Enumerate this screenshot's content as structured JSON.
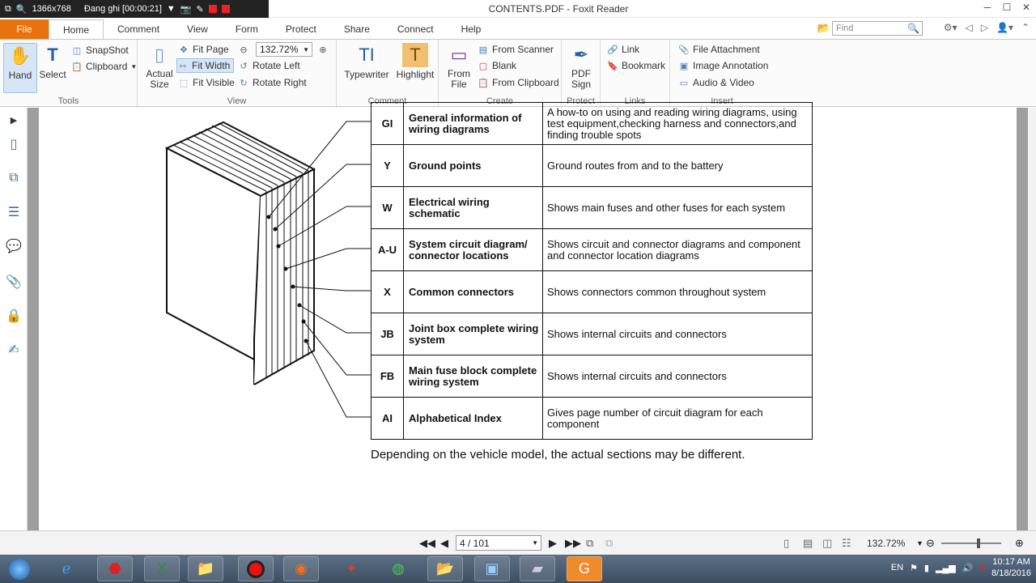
{
  "recorder": {
    "resolution": "1366x768",
    "status": "Đang ghi [00:00:21]"
  },
  "window": {
    "title": "CONTENTS.PDF - Foxit Reader"
  },
  "tabs": [
    "Home",
    "Comment",
    "View",
    "Form",
    "Protect",
    "Share",
    "Connect",
    "Help"
  ],
  "file_tab": "File",
  "find": {
    "placeholder": "Find"
  },
  "ribbon": {
    "tools": {
      "label": "Tools",
      "hand": "Hand",
      "select": "Select",
      "snapshot": "SnapShot",
      "clipboard": "Clipboard"
    },
    "view": {
      "label": "View",
      "actual_size": "Actual Size",
      "fit_page": "Fit Page",
      "fit_width": "Fit Width",
      "fit_visible": "Fit Visible",
      "zoom": "132.72%",
      "rotate_left": "Rotate Left",
      "rotate_right": "Rotate Right"
    },
    "comment": {
      "label": "Comment",
      "typewriter": "Typewriter",
      "highlight": "Highlight"
    },
    "create": {
      "label": "Create",
      "from_file": "From File",
      "from_scanner": "From Scanner",
      "blank": "Blank",
      "from_clipboard": "From Clipboard"
    },
    "protect": {
      "label": "Protect",
      "pdf_sign": "PDF Sign"
    },
    "links": {
      "label": "Links",
      "link": "Link",
      "bookmark": "Bookmark"
    },
    "insert": {
      "label": "Insert",
      "file_attachment": "File Attachment",
      "image_annotation": "Image Annotation",
      "audio_video": "Audio & Video"
    }
  },
  "document": {
    "rows": [
      {
        "code": "GI",
        "section": "General information of wiring diagrams",
        "desc": "A how-to on using and reading wiring diagrams, using test equipment,checking harness and connectors,and finding trouble spots"
      },
      {
        "code": "Y",
        "section": "Ground points",
        "desc": "Ground routes from and to the battery"
      },
      {
        "code": "W",
        "section": "Electrical wiring schematic",
        "desc": "Shows main fuses and other fuses for each system"
      },
      {
        "code": "A-U",
        "section": "System circuit diagram/ connector locations",
        "desc": "Shows circuit and connector diagrams and component and connector location diagrams"
      },
      {
        "code": "X",
        "section": "Common connectors",
        "desc": "Shows connectors common throughout system"
      },
      {
        "code": "JB",
        "section": "Joint box complete wiring system",
        "desc": "Shows internal circuits and connectors"
      },
      {
        "code": "FB",
        "section": "Main fuse block complete wiring system",
        "desc": "Shows internal circuits and connectors"
      },
      {
        "code": "AI",
        "section": "Alphabetical Index",
        "desc": "Gives page number of circuit diagram for each component"
      }
    ],
    "note": "Depending on the vehicle model, the actual sections may be different."
  },
  "navigation": {
    "page": "4 / 101",
    "zoom": "132.72%"
  },
  "tray": {
    "lang": "EN",
    "time": "10:17 AM",
    "date": "8/18/2016"
  },
  "colors": {
    "file_tab": "#e8730e",
    "ribbon_bg": "#fbfbfb",
    "viewer_bg": "#9e9e9e",
    "taskbar": "#46586e"
  }
}
